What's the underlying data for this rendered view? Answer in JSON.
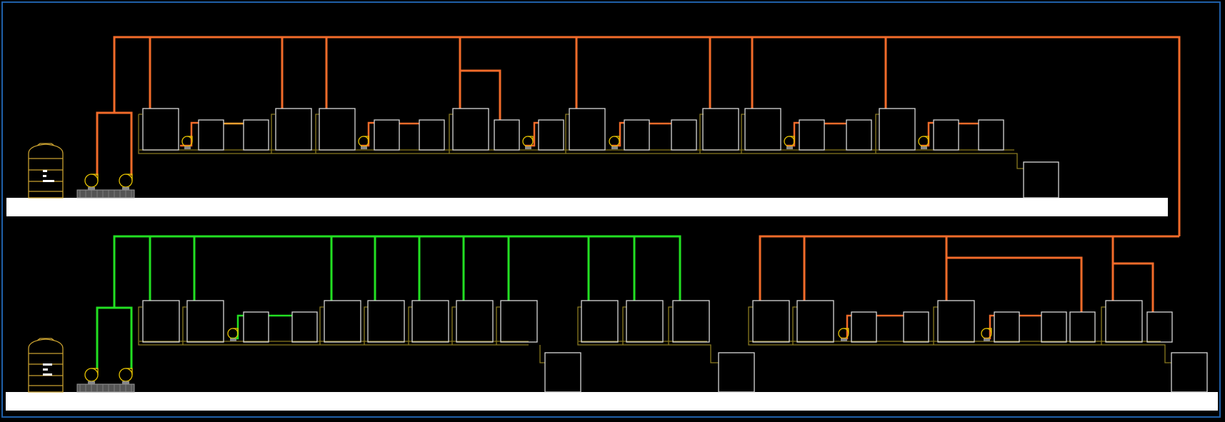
{
  "colors": {
    "background": "#000000",
    "frame": "#1f5fa8",
    "floor_slab": "#ffffff",
    "supply_pipe_upper": "#f26b2a",
    "supply_pipe_lower_left": "#22e022",
    "supply_pipe_lower_right": "#f26b2a",
    "equipment_outline": "#d8d8d8",
    "base_outline": "#8a7a20",
    "pump": "#e6c200",
    "tank": "#c8a030",
    "tank_gauge": "#ffffff"
  },
  "icons": {
    "pump": "pump-icon",
    "tank": "water-tank-icon",
    "unit": "equipment-unit"
  }
}
